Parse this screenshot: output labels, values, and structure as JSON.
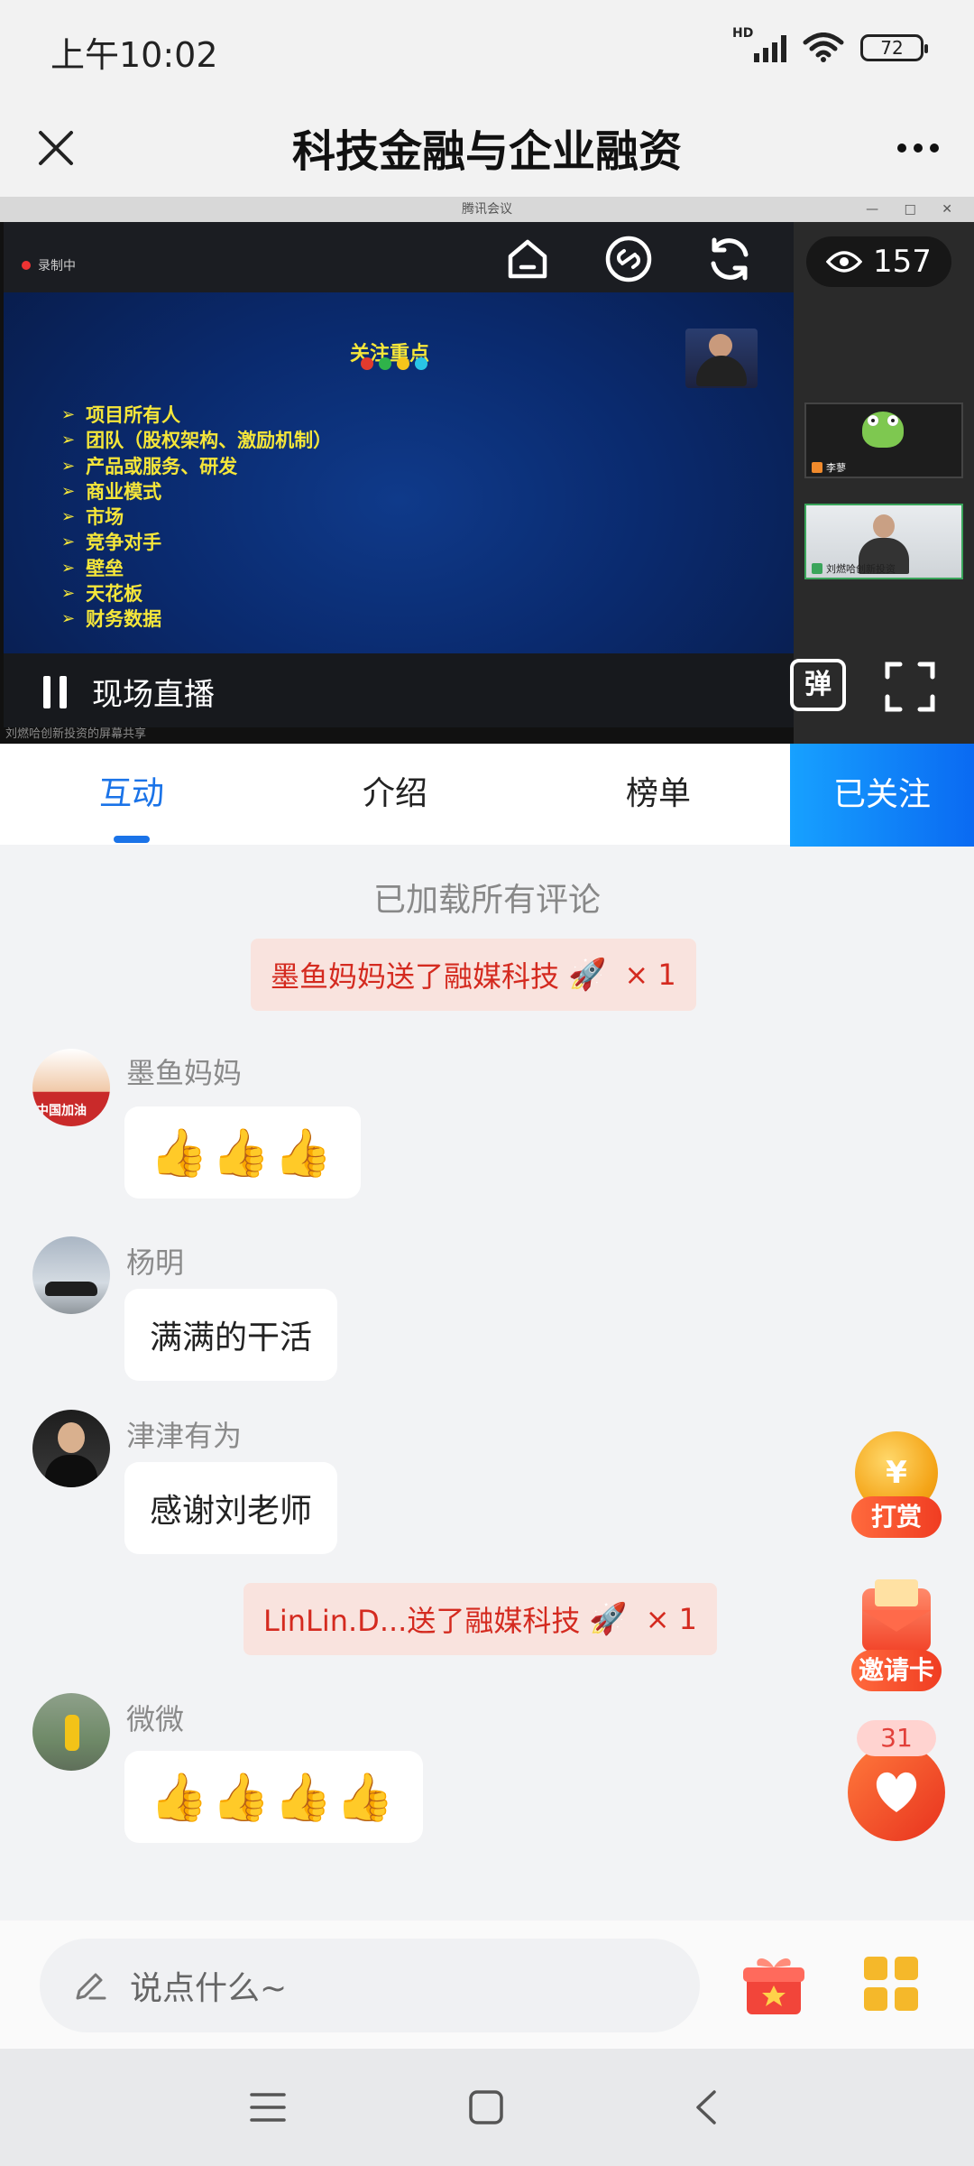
{
  "status_bar": {
    "time": "上午10:02",
    "network": "HD",
    "battery": "72"
  },
  "header": {
    "title": "科技金融与企业融资"
  },
  "video": {
    "window_title": "腾讯会议",
    "recording_label": "录制中",
    "slide_heading": "关注重点",
    "slide_items": [
      "项目所有人",
      "团队（股权架构、激励机制）",
      "产品或服务、研发",
      "商业模式",
      "市场",
      "竞争对手",
      "壁垒",
      "天花板",
      "财务数据"
    ],
    "participants": [
      {
        "name": "李蓼"
      },
      {
        "name": "刘燃哈创新投资"
      }
    ],
    "viewer_count": "157",
    "live_label": "现场直播",
    "danmu_label": "弹",
    "share_note": "刘燃哈创新投资的屏幕共享"
  },
  "tabs": {
    "items": [
      "互动",
      "介绍",
      "榜单"
    ],
    "active": "互动",
    "follow_label": "已关注"
  },
  "chat": {
    "loaded_note": "已加载所有评论",
    "gift1": {
      "text": "墨鱼妈妈送了融媒科技",
      "icon": "🚀",
      "count": "× 1"
    },
    "gift2": {
      "text": "LinLin.D...送了融媒科技",
      "icon": "🚀",
      "count": "× 1"
    },
    "messages": [
      {
        "user": "墨鱼妈妈",
        "text": "👍👍👍",
        "avatar_text": "中国加油"
      },
      {
        "user": "杨明",
        "text": "满满的干活"
      },
      {
        "user": "津津有为",
        "text": "感谢刘老师"
      },
      {
        "user": "微微",
        "text": "👍👍👍👍"
      }
    ]
  },
  "floating": {
    "reward_label": "打赏",
    "reward_symbol": "¥",
    "invite_label": "邀请卡",
    "like_count": "31"
  },
  "input": {
    "placeholder": "说点什么~"
  }
}
